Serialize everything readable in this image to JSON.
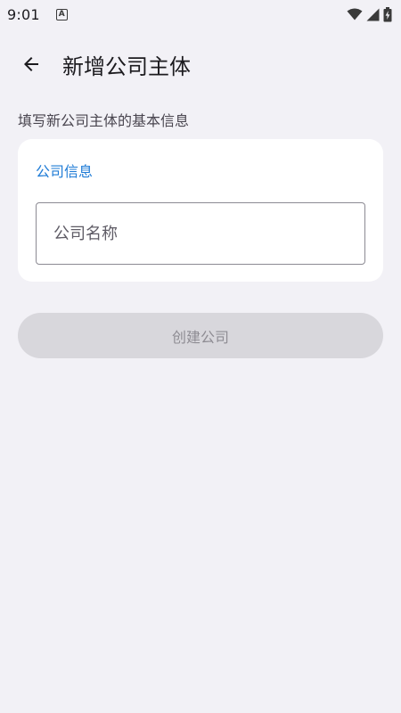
{
  "status_bar": {
    "time": "9:01",
    "notification_letter": "A",
    "icons": [
      "wifi-icon",
      "cellular-signal-icon",
      "battery-charging-icon"
    ]
  },
  "app_bar": {
    "back_icon": "arrow-left-icon",
    "title": "新增公司主体"
  },
  "subtitle": "填写新公司主体的基本信息",
  "card": {
    "section_title": "公司信息",
    "company_name_field": {
      "value": "",
      "placeholder": "公司名称"
    }
  },
  "create_button": {
    "label": "创建公司",
    "enabled": false
  },
  "colors": {
    "background": "#F2F1F6",
    "card": "#FFFFFF",
    "accent": "#1E7BD6",
    "disabled_button": "#D8D7DC",
    "disabled_text": "#8E8C93"
  }
}
